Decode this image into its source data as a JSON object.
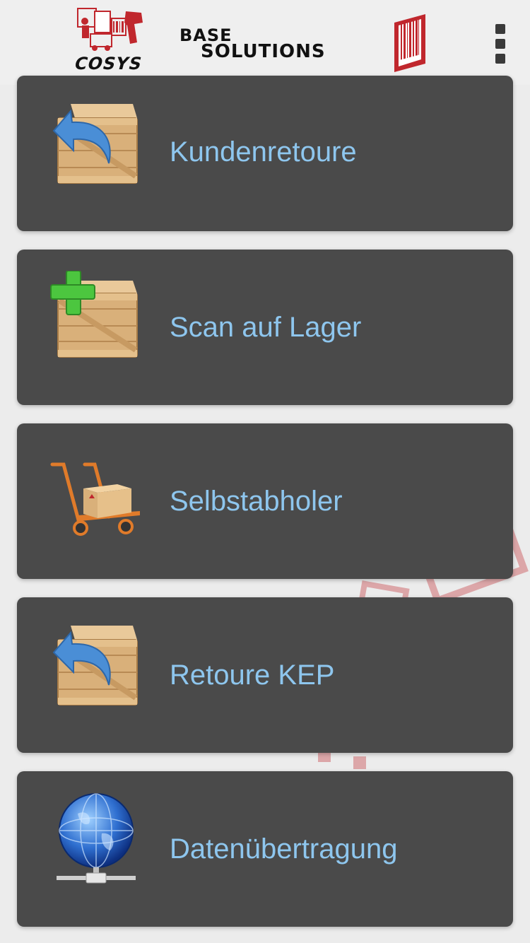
{
  "header": {
    "logo_cosys_text": "COSYS",
    "logo_base_line1": "BASE",
    "logo_base_line2": "SOLUTIONS",
    "menu_icon": "overflow-menu-icon"
  },
  "menu": {
    "items": [
      {
        "label": "Kundenretoure",
        "icon": "crate-return-icon"
      },
      {
        "label": "Scan auf Lager",
        "icon": "crate-add-icon"
      },
      {
        "label": "Selbstabholer",
        "icon": "hand-truck-icon"
      },
      {
        "label": "Retoure KEP",
        "icon": "crate-return-icon"
      },
      {
        "label": "Datenübertragung",
        "icon": "network-globe-icon"
      }
    ]
  },
  "colors": {
    "tile_background": "#4a4a4a",
    "label_color": "#8ec6ee",
    "brand_red": "#c0272d"
  }
}
